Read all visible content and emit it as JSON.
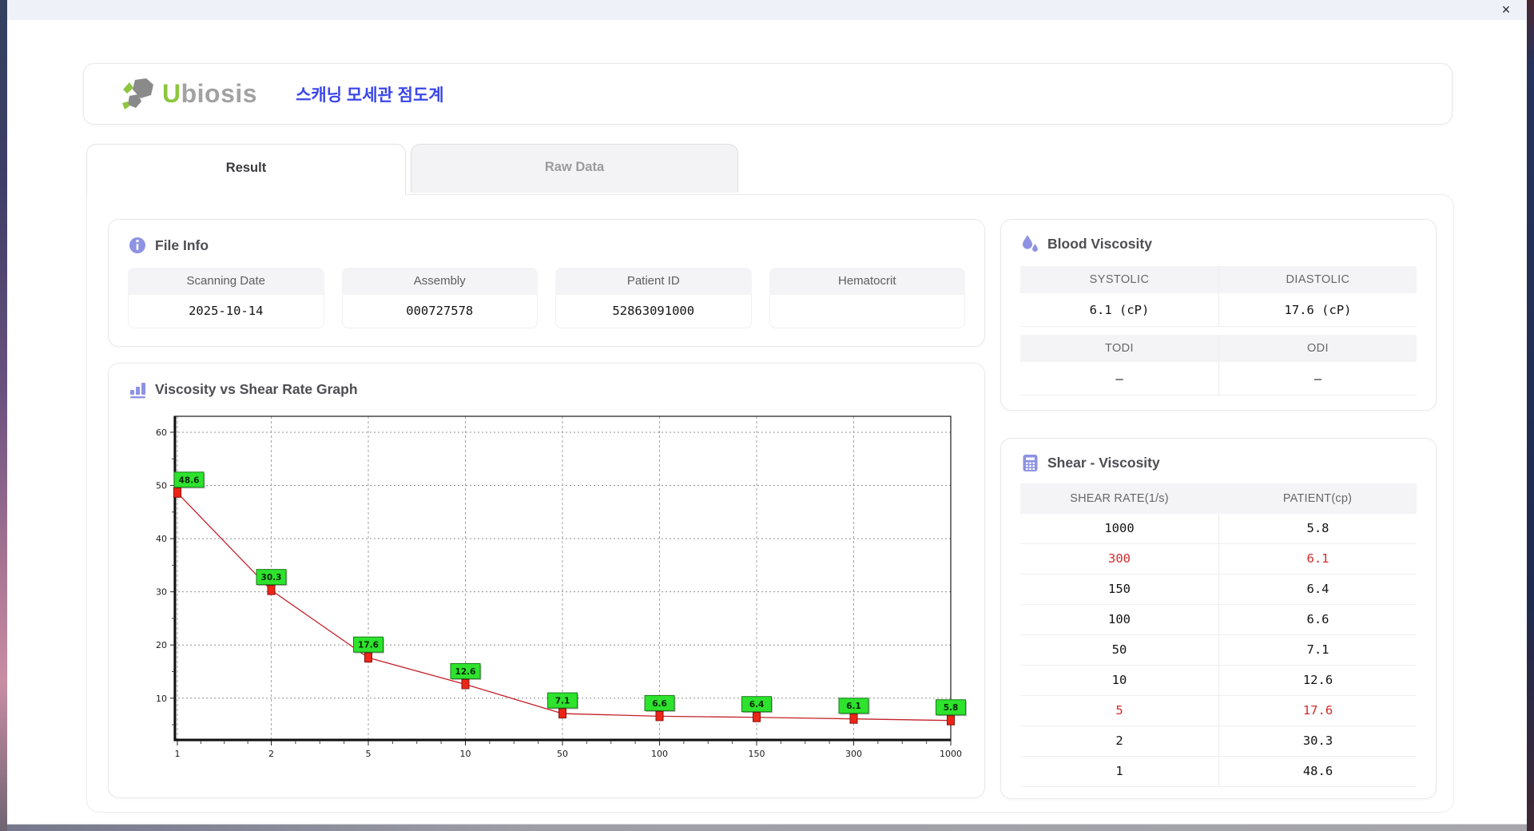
{
  "window": {
    "close_glyph": "×"
  },
  "header": {
    "logo": {
      "u": "U",
      "rest": "biosis"
    },
    "korean_title": "스캐닝 모세관 점도계"
  },
  "tabs": [
    {
      "label": "Result",
      "active": true
    },
    {
      "label": "Raw Data",
      "active": false
    }
  ],
  "file_info": {
    "title": "File Info",
    "fields": [
      {
        "label": "Scanning Date",
        "value": "2025-10-14"
      },
      {
        "label": "Assembly",
        "value": "000727578"
      },
      {
        "label": "Patient ID",
        "value": "52863091000"
      },
      {
        "label": "Hematocrit",
        "value": ""
      }
    ]
  },
  "blood_viscosity": {
    "title": "Blood Viscosity",
    "groups": [
      {
        "headers": [
          "SYSTOLIC",
          "DIASTOLIC"
        ],
        "values": [
          "6.1 (cP)",
          "17.6 (cP)"
        ]
      },
      {
        "headers": [
          "TODI",
          "ODI"
        ],
        "values": [
          "–",
          "–"
        ]
      }
    ]
  },
  "shear_viscosity": {
    "title": "Shear - Viscosity",
    "columns": [
      "SHEAR RATE(1/s)",
      "PATIENT(cp)"
    ],
    "rows": [
      {
        "shear_rate": "1000",
        "patient": "5.8",
        "highlight": false
      },
      {
        "shear_rate": "300",
        "patient": "6.1",
        "highlight": true
      },
      {
        "shear_rate": "150",
        "patient": "6.4",
        "highlight": false
      },
      {
        "shear_rate": "100",
        "patient": "6.6",
        "highlight": false
      },
      {
        "shear_rate": "50",
        "patient": "7.1",
        "highlight": false
      },
      {
        "shear_rate": "10",
        "patient": "12.6",
        "highlight": false
      },
      {
        "shear_rate": "5",
        "patient": "17.6",
        "highlight": true
      },
      {
        "shear_rate": "2",
        "patient": "30.3",
        "highlight": false
      },
      {
        "shear_rate": "1",
        "patient": "48.6",
        "highlight": false
      }
    ]
  },
  "graph": {
    "title": "Viscosity vs Shear Rate Graph"
  },
  "chart_data": {
    "type": "line",
    "title": "Viscosity vs Shear Rate Graph",
    "x_categories": [
      "1",
      "2",
      "5",
      "10",
      "50",
      "100",
      "150",
      "300",
      "1000"
    ],
    "series": [
      {
        "name": "PATIENT(cp)",
        "values": [
          48.6,
          30.3,
          17.6,
          12.6,
          7.1,
          6.6,
          6.4,
          6.1,
          5.8
        ]
      }
    ],
    "point_labels": [
      "48.6",
      "30.3",
      "17.6",
      "12.6",
      "7.1",
      "6.6",
      "6.4",
      "6.1",
      "5.8"
    ],
    "xlabel": "",
    "ylabel": "",
    "y_ticks": [
      10,
      20,
      30,
      40,
      50,
      60
    ],
    "ylim": [
      2,
      63
    ],
    "x_scale": "categorical",
    "grid": true,
    "legend": "none",
    "line_color": "#c4202a",
    "marker_color": "#ec2616",
    "marker_border": "#8c1010",
    "label_bg": "#2de32d",
    "label_border": "#1c7a1c"
  },
  "colors": {
    "accent_purple": "#8e92e3",
    "brand_green": "#8cc63f",
    "brand_gray": "#a2a2a2",
    "title_blue": "#3b46e9",
    "highlight_red": "#d32b2b",
    "titlebar_bg": "#eef1f8"
  }
}
